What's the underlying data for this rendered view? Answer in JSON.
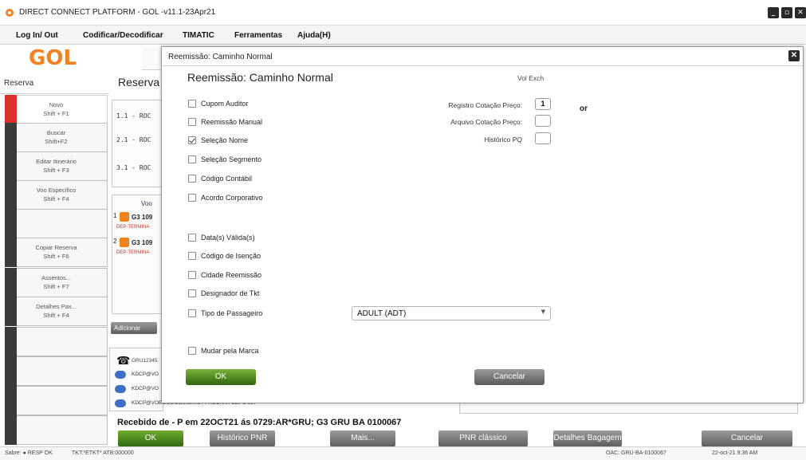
{
  "window": {
    "title": "DIRECT CONNECT PLATFORM - GOL -v11.1-23Apr21",
    "controls": [
      "minimize-icon",
      "restore-icon",
      "close-icon"
    ]
  },
  "menu": [
    "Log In/ Out",
    "Codificar/Decodificar",
    "TIMATIC",
    "Ferramentas",
    "Ajuda(H)"
  ],
  "logo": "GOL",
  "sidebar": {
    "header": "Reserva",
    "buttons": [
      {
        "label": "Novo",
        "shortcut": "Shift + F1",
        "active": true
      },
      {
        "label": "Buscar",
        "shortcut": "Shift+F2"
      },
      {
        "label": "Editar Itinerário",
        "shortcut": "Shift + F3"
      },
      {
        "label": "Voo Específico",
        "shortcut": "Shift + F4"
      },
      {
        "label": "",
        "shortcut": ""
      },
      {
        "label": "Copiar Reserva",
        "shortcut": "Shift + F6"
      },
      {
        "label": "Assentos...",
        "shortcut": "Shift + F7"
      },
      {
        "label": "Detalhes Pax...",
        "shortcut": "Shift + F4"
      },
      {
        "label": "",
        "shortcut": ""
      },
      {
        "label": "",
        "shortcut": ""
      },
      {
        "label": "",
        "shortcut": ""
      },
      {
        "label": "",
        "shortcut": ""
      }
    ]
  },
  "main": {
    "title": "Reserva",
    "rows": [
      "1.1 -  ROC",
      "2.1 -  ROC",
      "3.1 -  ROC"
    ],
    "voo_label": "Voo",
    "flights": [
      {
        "num": "1",
        "code": "G3 109",
        "sub": "DEP-TERMINA"
      },
      {
        "num": "2",
        "code": "G3 109",
        "sub": "DEP-TERMINA"
      }
    ],
    "adicionar": "Adicionar",
    "contacts": [
      "GRU12345",
      "KDCP@VO",
      "KDCP@VO",
      "KDCP@VOEGOL.COM.BR/CT FROCHA/FELIPE 657"
    ],
    "received": "Recebido de - P em 22OCT21  ás 0729:AR*GRU; G3 GRU BA 0100067"
  },
  "bottom_buttons": [
    "OK",
    "Histórico PNR",
    "Mais...",
    "PNR clássico",
    "Detalhes Bagagem",
    "Cancelar"
  ],
  "status": {
    "left": "Sabre: ● RESP OK",
    "tkt": "TKT:*ETKT* ATB:000000",
    "oac": "OAC: GRU-BA-0100067",
    "datetime": "22-oct-21 9:36 AM"
  },
  "dialog": {
    "window_title": "Reemissão: Caminho Normal",
    "heading": "Reemissão: Caminho Normal",
    "vol_exch": "Vol Exch",
    "checkboxes_top": [
      {
        "label": "Cupom Auditor",
        "checked": false
      },
      {
        "label": "Reemissão Manual",
        "checked": false
      },
      {
        "label": "Seleção Nome",
        "checked": true
      },
      {
        "label": "Seleção Segmento",
        "checked": false
      },
      {
        "label": "Código Contábil",
        "checked": false
      },
      {
        "label": "Acordo Corporativo",
        "checked": false
      }
    ],
    "checkboxes_bottom": [
      {
        "label": "Data(s) Válida(s)",
        "checked": false
      },
      {
        "label": "Código de Isenção",
        "checked": false
      },
      {
        "label": "Cidade Reemissão",
        "checked": false
      },
      {
        "label": "Designador de Tkt",
        "checked": false
      },
      {
        "label": "Tipo de Passageiro",
        "checked": false
      }
    ],
    "mudar_marca": {
      "label": "Mudar pela Marca",
      "checked": false
    },
    "registro_label": "Registro Cotação Preço:",
    "registro_value": "1",
    "arquivo_label": "Arquivo Cotação Preço:",
    "arquivo_value": "",
    "historico_label": "Histórico PQ",
    "historico_value": "",
    "or_label": "or",
    "passenger_type": "ADULT (ADT)",
    "ok": "OK",
    "cancel": "Cancelar"
  }
}
